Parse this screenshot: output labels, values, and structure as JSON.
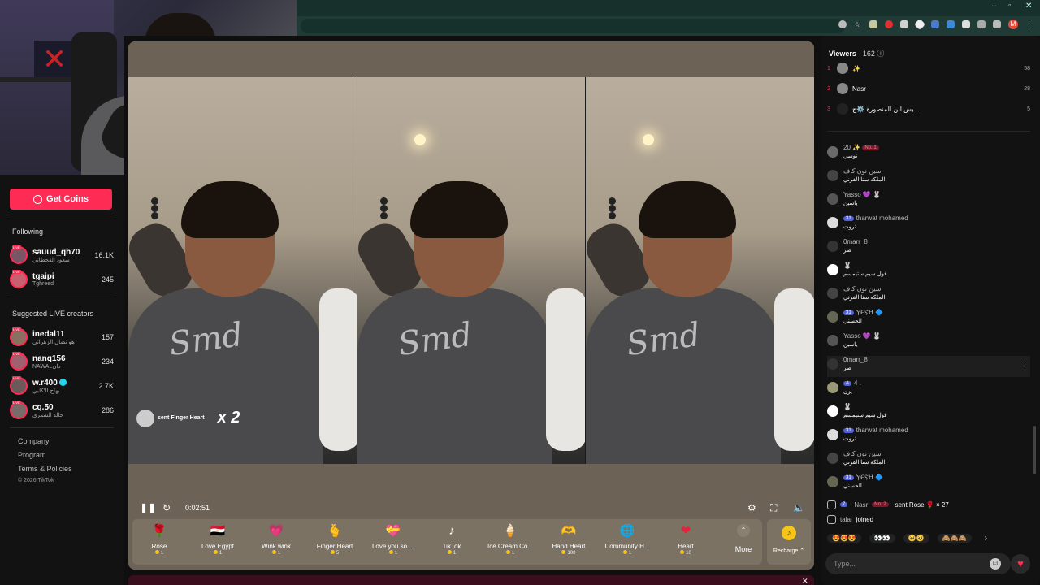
{
  "browser": {
    "colors": {
      "chrome": "#1c3430",
      "accent": "#fe2c55"
    },
    "profile_initial": "M"
  },
  "sidebar": {
    "get_coins": "Get Coins",
    "following_title": "Following",
    "following": [
      {
        "name": "sauud_qh70",
        "sub": "سعود القحطاني",
        "count": "16.1K"
      },
      {
        "name": "tgaipi",
        "sub": "Tghreed",
        "count": "245"
      }
    ],
    "suggested_title": "Suggested LIVE creators",
    "suggested": [
      {
        "name": "inedal11",
        "sub": "هو نضال الزهراني",
        "count": "157"
      },
      {
        "name": "nanq156",
        "sub": "NAWALدان",
        "count": "234"
      },
      {
        "name": "w.r400",
        "sub": "بهاج الاكلبي",
        "count": "2.7K",
        "verified": true
      },
      {
        "name": "cq.50",
        "sub": "خالد الشمري",
        "count": "286"
      }
    ],
    "links": [
      "Company",
      "Program",
      "Terms & Policies"
    ],
    "copyright": "© 2026 TikTok"
  },
  "player": {
    "gift_popup": {
      "text": "sent Finger Heart",
      "multiplier": "x 2"
    },
    "shirt_text": "Smd",
    "time": "0:02:51",
    "gifts": [
      {
        "name": "Rose",
        "price": "1",
        "icon": "🌹"
      },
      {
        "name": "Love Egypt",
        "price": "1",
        "icon": "🇪🇬"
      },
      {
        "name": "Wink wink",
        "price": "1",
        "icon": "💗"
      },
      {
        "name": "Finger Heart",
        "price": "5",
        "icon": "🫰"
      },
      {
        "name": "Love you so ...",
        "price": "1",
        "icon": "💝"
      },
      {
        "name": "TikTok",
        "price": "1",
        "icon": "♪"
      },
      {
        "name": "Ice Cream Co...",
        "price": "1",
        "icon": "🍦"
      },
      {
        "name": "Hand Heart",
        "price": "100",
        "icon": "🫶"
      },
      {
        "name": "Community H...",
        "price": "1",
        "icon": "🌐"
      },
      {
        "name": "Heart",
        "price": "10",
        "icon": "❤"
      }
    ],
    "more_label": "More",
    "recharge_label": "Recharge ⌃"
  },
  "chat": {
    "viewers_label": "Viewers",
    "viewers_count": "· 162",
    "top_viewers": [
      {
        "rank": "1",
        "name": "✨",
        "count": "58"
      },
      {
        "rank": "2",
        "name": "Nasr",
        "count": "28"
      },
      {
        "rank": "3",
        "name": "بس ابن المنصورة ⚙️ج...",
        "count": "5"
      }
    ],
    "messages": [
      {
        "user": "20 ✨",
        "badge": "No. 1",
        "text": "نوسي"
      },
      {
        "user": "سين نون كاف",
        "text": "الملكه سنا الفرني"
      },
      {
        "user": "Yasso 💜 🐰",
        "text": "ياسين"
      },
      {
        "user": "tharwat mohamed",
        "badge_lvl": "31",
        "text": "ثروت"
      },
      {
        "user": "0marr_8",
        "text": "صر"
      },
      {
        "user": "🐰",
        "text": "فول سيم ستيمسم"
      },
      {
        "user": "سين نون كاف",
        "text": "الملكه سنا الفرني"
      },
      {
        "user": "ⲨⲈⲊⲎ 🔷",
        "badge_lvl": "31",
        "text": "الحسني"
      },
      {
        "user": "Yasso 💜 🐰",
        "text": "ياسين"
      },
      {
        "user": "0marr_8",
        "text": "صر"
      },
      {
        "user": "4 .",
        "text": "يزن"
      },
      {
        "user": "🐰",
        "text": "فول سيم ستيمسم"
      },
      {
        "user": "tharwat mohamed",
        "badge_lvl": "31",
        "text": "ثروت"
      },
      {
        "user": "سين نون كاف",
        "text": "الملكه سنا الفرني"
      },
      {
        "user": "ⲨⲈⲊⲎ 🔷",
        "badge_lvl": "31",
        "text": "الحسني"
      }
    ],
    "gift_event": {
      "badge": "7",
      "user": "Nasr",
      "rank_badge": "No. 2",
      "text": "sent Rose 🌹 × 27"
    },
    "join_event": {
      "user": "talal",
      "text": "joined"
    },
    "emoji_quick": [
      "😍😍😍",
      "👀👀",
      "🥺🥺",
      "🙈🙈🙈"
    ],
    "input_placeholder": "Type..."
  }
}
